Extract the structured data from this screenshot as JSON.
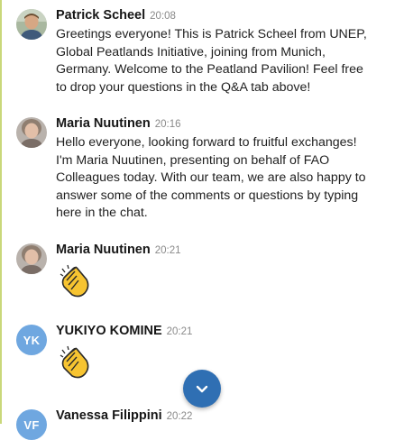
{
  "messages": [
    {
      "name": "Patrick Scheel",
      "time": "20:08",
      "text": "Greetings everyone! This is Patrick Scheel from UNEP,\nGlobal Peatlands Initiative, joining from Munich,\nGermany. Welcome to the Peatland Pavilion! Feel free\nto drop your questions in the Q&A tab above!"
    },
    {
      "name": "Maria Nuutinen",
      "time": "20:16",
      "text": "Hello everyone, looking forward to fruitful exchanges!\nI'm Maria Nuutinen, presenting on behalf of FAO\nColleagues today. With our team, we are also happy to\nanswer some of the comments or questions by typing\nhere in the chat."
    },
    {
      "name": "Maria Nuutinen",
      "time": "20:21",
      "emoji": "clapping-hands-icon"
    },
    {
      "name": "YUKIYO KOMINE",
      "time": "20:21",
      "initials": "YK",
      "avatar_color": "#6fa7e0",
      "emoji": "clapping-hands-icon"
    },
    {
      "name": "Vanessa Filippini",
      "time": "20:22",
      "initials": "VF",
      "avatar_color": "#6fa7e0"
    }
  ],
  "scroll_button": {
    "icon": "chevron-down-icon",
    "color": "#2f6fb3"
  }
}
